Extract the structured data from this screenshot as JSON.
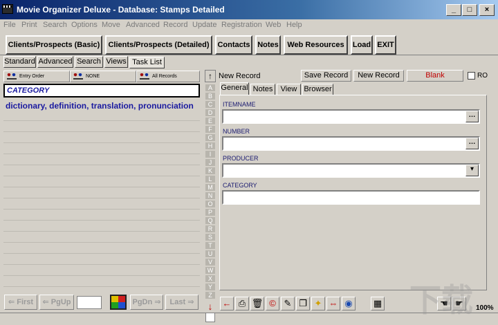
{
  "window": {
    "title": "Movie Organizer Deluxe - Database: Stamps Detailed"
  },
  "menu": [
    "File",
    "Print",
    "Search",
    "Options",
    "Move",
    "Advanced",
    "Record",
    "Update",
    "Registration",
    "Web",
    "Help"
  ],
  "toolbar": {
    "clients_basic": "Clients/Prospects (Basic)",
    "clients_detailed": "Clients/Prospects (Detailed)",
    "contacts": "Contacts",
    "notes": "Notes",
    "web_resources": "Web Resources",
    "load": "Load",
    "exit": "EXIT"
  },
  "left_tabs": [
    "Standard",
    "Advanced",
    "Search",
    "Views",
    "Task List"
  ],
  "sort": {
    "order": "Entry Order",
    "filter": "NONE",
    "records": "All Records"
  },
  "list": {
    "header": "CATEGORY",
    "rows": [
      "dictionary, definition, translation, pronunciation"
    ]
  },
  "nav": {
    "first": "First",
    "pgup": "PgUp",
    "pgdn": "PgDn",
    "last": "Last"
  },
  "alphabet": [
    "A",
    "B",
    "C",
    "D",
    "E",
    "F",
    "G",
    "H",
    "I",
    "J",
    "K",
    "L",
    "M",
    "N",
    "O",
    "P",
    "Q",
    "R",
    "S",
    "T",
    "U",
    "V",
    "W",
    "X",
    "Y",
    "Z"
  ],
  "record": {
    "status": "New Record",
    "save": "Save Record",
    "new": "New Record",
    "blank": "Blank",
    "ro": "RO"
  },
  "record_tabs": [
    "General",
    "Notes",
    "View",
    "Browser"
  ],
  "fields": {
    "itemname": {
      "label": "ITEMNAME",
      "value": ""
    },
    "number": {
      "label": "NUMBER",
      "value": ""
    },
    "producer": {
      "label": "PRODUCER",
      "value": ""
    },
    "category": {
      "label": "CATEGORY",
      "value": ""
    }
  },
  "status": {
    "zoom": "100%"
  },
  "colors": {
    "accent_blue": "#1a1aa0",
    "blank_red": "#c00000"
  }
}
